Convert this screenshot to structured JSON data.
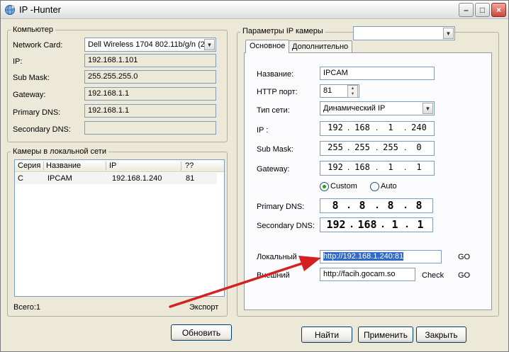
{
  "window": {
    "title": "IP -Hunter"
  },
  "computer": {
    "group_title": "Компьютер",
    "network_card_label": "Network Card:",
    "network_card_value": "Dell Wireless 1704 802.11b/g/n (2",
    "ip_label": "IP:",
    "ip_value": "192.168.1.101",
    "submask_label": "Sub Mask:",
    "submask_value": "255.255.255.0",
    "gateway_label": "Gateway:",
    "gateway_value": "192.168.1.1",
    "primary_dns_label": "Primary DNS:",
    "primary_dns_value": "192.168.1.1",
    "secondary_dns_label": "Secondary DNS:",
    "secondary_dns_value": ""
  },
  "cameras": {
    "group_title": "Камеры в локальной сети",
    "columns": [
      "Серия",
      "Название",
      "IP",
      "??"
    ],
    "rows": [
      {
        "series": "C",
        "name": "IPCAM",
        "ip": "192.168.1.240",
        "port": "81"
      }
    ],
    "total_label": "Всего:1",
    "export_label": "Экспорт"
  },
  "refresh_button": "Обновить",
  "camera_params": {
    "group_title": "Параметры IP камеры",
    "selector_value": "",
    "tabs": [
      "Основное",
      "Дополнительно"
    ],
    "name_label": "Название:",
    "name_value": "IPCAM",
    "http_port_label": "HTTP порт:",
    "http_port_value": "81",
    "net_type_label": "Тип сети:",
    "net_type_value": "Динамический IP",
    "ip_label": "IP  :",
    "ip_octets": [
      "192",
      "168",
      "1",
      "240"
    ],
    "submask_label": "Sub Mask:",
    "submask_octets": [
      "255",
      "255",
      "255",
      "0"
    ],
    "gateway_label": "Gateway:",
    "gateway_octets": [
      "192",
      "168",
      "1",
      "1"
    ],
    "custom_label": "Custom",
    "auto_label": "Auto",
    "primary_dns_label": "Primary DNS:",
    "primary_dns_octets": [
      "8",
      "8",
      "8",
      "8"
    ],
    "secondary_dns_label": "Secondary DNS:",
    "secondary_dns_octets": [
      "192",
      "168",
      "1",
      "1"
    ],
    "local_label": "Локальный",
    "local_url": "http://192.168.1.240:81",
    "local_go": "GO",
    "external_label": "Внешний",
    "external_url": "http://facih.gocam.so",
    "check_label": "Check",
    "external_go": "GO"
  },
  "buttons": {
    "find": "Найти",
    "apply": "Применить",
    "close": "Закрыть"
  },
  "colors": {
    "arrow": "#d42020",
    "selection": "#316ac5"
  },
  "icons": {
    "app": "globe-icon",
    "minimize": "minimize-icon",
    "maximize": "maximize-icon",
    "close": "close-icon"
  }
}
